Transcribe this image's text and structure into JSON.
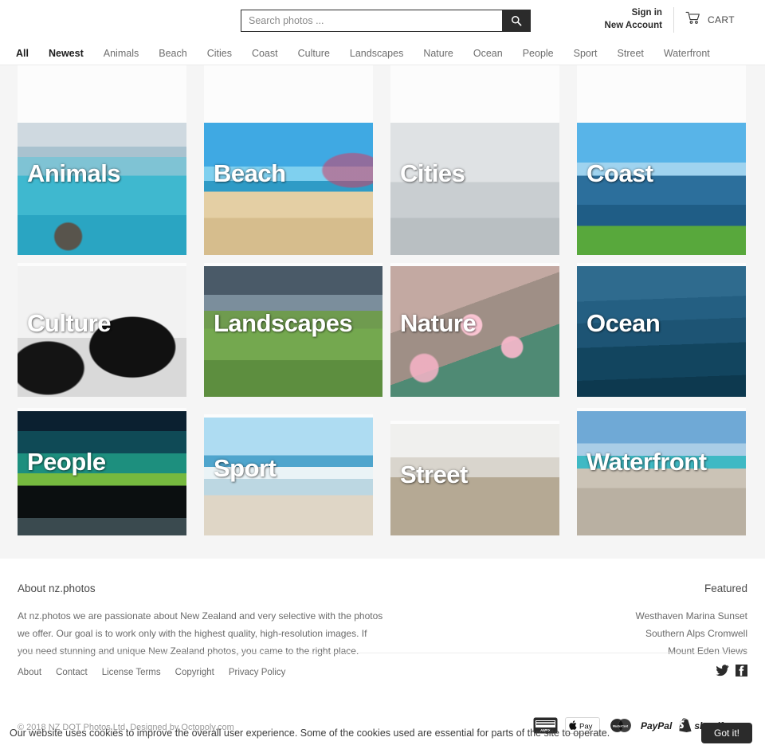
{
  "header": {
    "search": {
      "placeholder": "Search photos ...",
      "value": "",
      "icon": "search-icon"
    },
    "account": {
      "signin": "Sign in",
      "new_account": "New Account"
    },
    "cart": {
      "label": "CART",
      "icon": "shopping-cart-icon"
    }
  },
  "nav": {
    "items": [
      {
        "label": "All",
        "active": true
      },
      {
        "label": "Newest",
        "active": true
      },
      {
        "label": "Animals",
        "active": false
      },
      {
        "label": "Beach",
        "active": false
      },
      {
        "label": "Cities",
        "active": false
      },
      {
        "label": "Coast",
        "active": false
      },
      {
        "label": "Culture",
        "active": false
      },
      {
        "label": "Landscapes",
        "active": false
      },
      {
        "label": "Nature",
        "active": false
      },
      {
        "label": "Ocean",
        "active": false
      },
      {
        "label": "People",
        "active": false
      },
      {
        "label": "Sport",
        "active": false
      },
      {
        "label": "Street",
        "active": false
      },
      {
        "label": "Waterfront",
        "active": false
      }
    ]
  },
  "grid": {
    "tiles": [
      {
        "label": "Animals",
        "scene": "animals"
      },
      {
        "label": "Beach",
        "scene": "beach"
      },
      {
        "label": "Cities",
        "scene": "cities"
      },
      {
        "label": "Coast",
        "scene": "coast"
      },
      {
        "label": "Culture",
        "scene": "culture"
      },
      {
        "label": "Landscapes",
        "scene": "landscapes"
      },
      {
        "label": "Nature",
        "scene": "nature"
      },
      {
        "label": "Ocean",
        "scene": "ocean"
      },
      {
        "label": "People",
        "scene": "people"
      },
      {
        "label": "Sport",
        "scene": "sport"
      },
      {
        "label": "Street",
        "scene": "street"
      },
      {
        "label": "Waterfront",
        "scene": "waterfront"
      }
    ]
  },
  "footer": {
    "about_title": "About nz.photos",
    "about_text": "At nz.photos we are passionate about New Zealand and very selective with the photos we offer. Our goal is to work only with the highest quality, high-resolution images. If you need stunning and unique New Zealand photos, you came to the right place.",
    "featured_title": "Featured",
    "featured_items": [
      "Westhaven Marina Sunset",
      "Southern Alps Cromwell",
      "Mount Eden Views"
    ],
    "links": [
      "About",
      "Contact",
      "License Terms",
      "Copyright",
      "Privacy Policy"
    ],
    "social": [
      {
        "name": "twitter-icon",
        "label": "Twitter"
      },
      {
        "name": "facebook-icon",
        "label": "Facebook"
      }
    ],
    "copyright": "© 2018 NZ DOT Photos Ltd.   Designed by Octopoly.com",
    "payments": [
      {
        "name": "american-express-icon",
        "label": "AMEX"
      },
      {
        "name": "apple-pay-icon",
        "label": "Pay"
      },
      {
        "name": "mastercard-icon",
        "label": "MasterCard"
      },
      {
        "name": "paypal-icon",
        "label": "PayPal"
      },
      {
        "name": "shopify-pay-icon",
        "label": "shopify pay"
      }
    ]
  },
  "cookie": {
    "text": "Our website uses cookies to improve the overall user experience. Some of the cookies used are essential for parts of the site to operate.",
    "button": "Got it!"
  },
  "colors": {
    "accent": "#2b2b2b",
    "page_bg": "#f5f5f5",
    "text": "#6a6a6a"
  }
}
